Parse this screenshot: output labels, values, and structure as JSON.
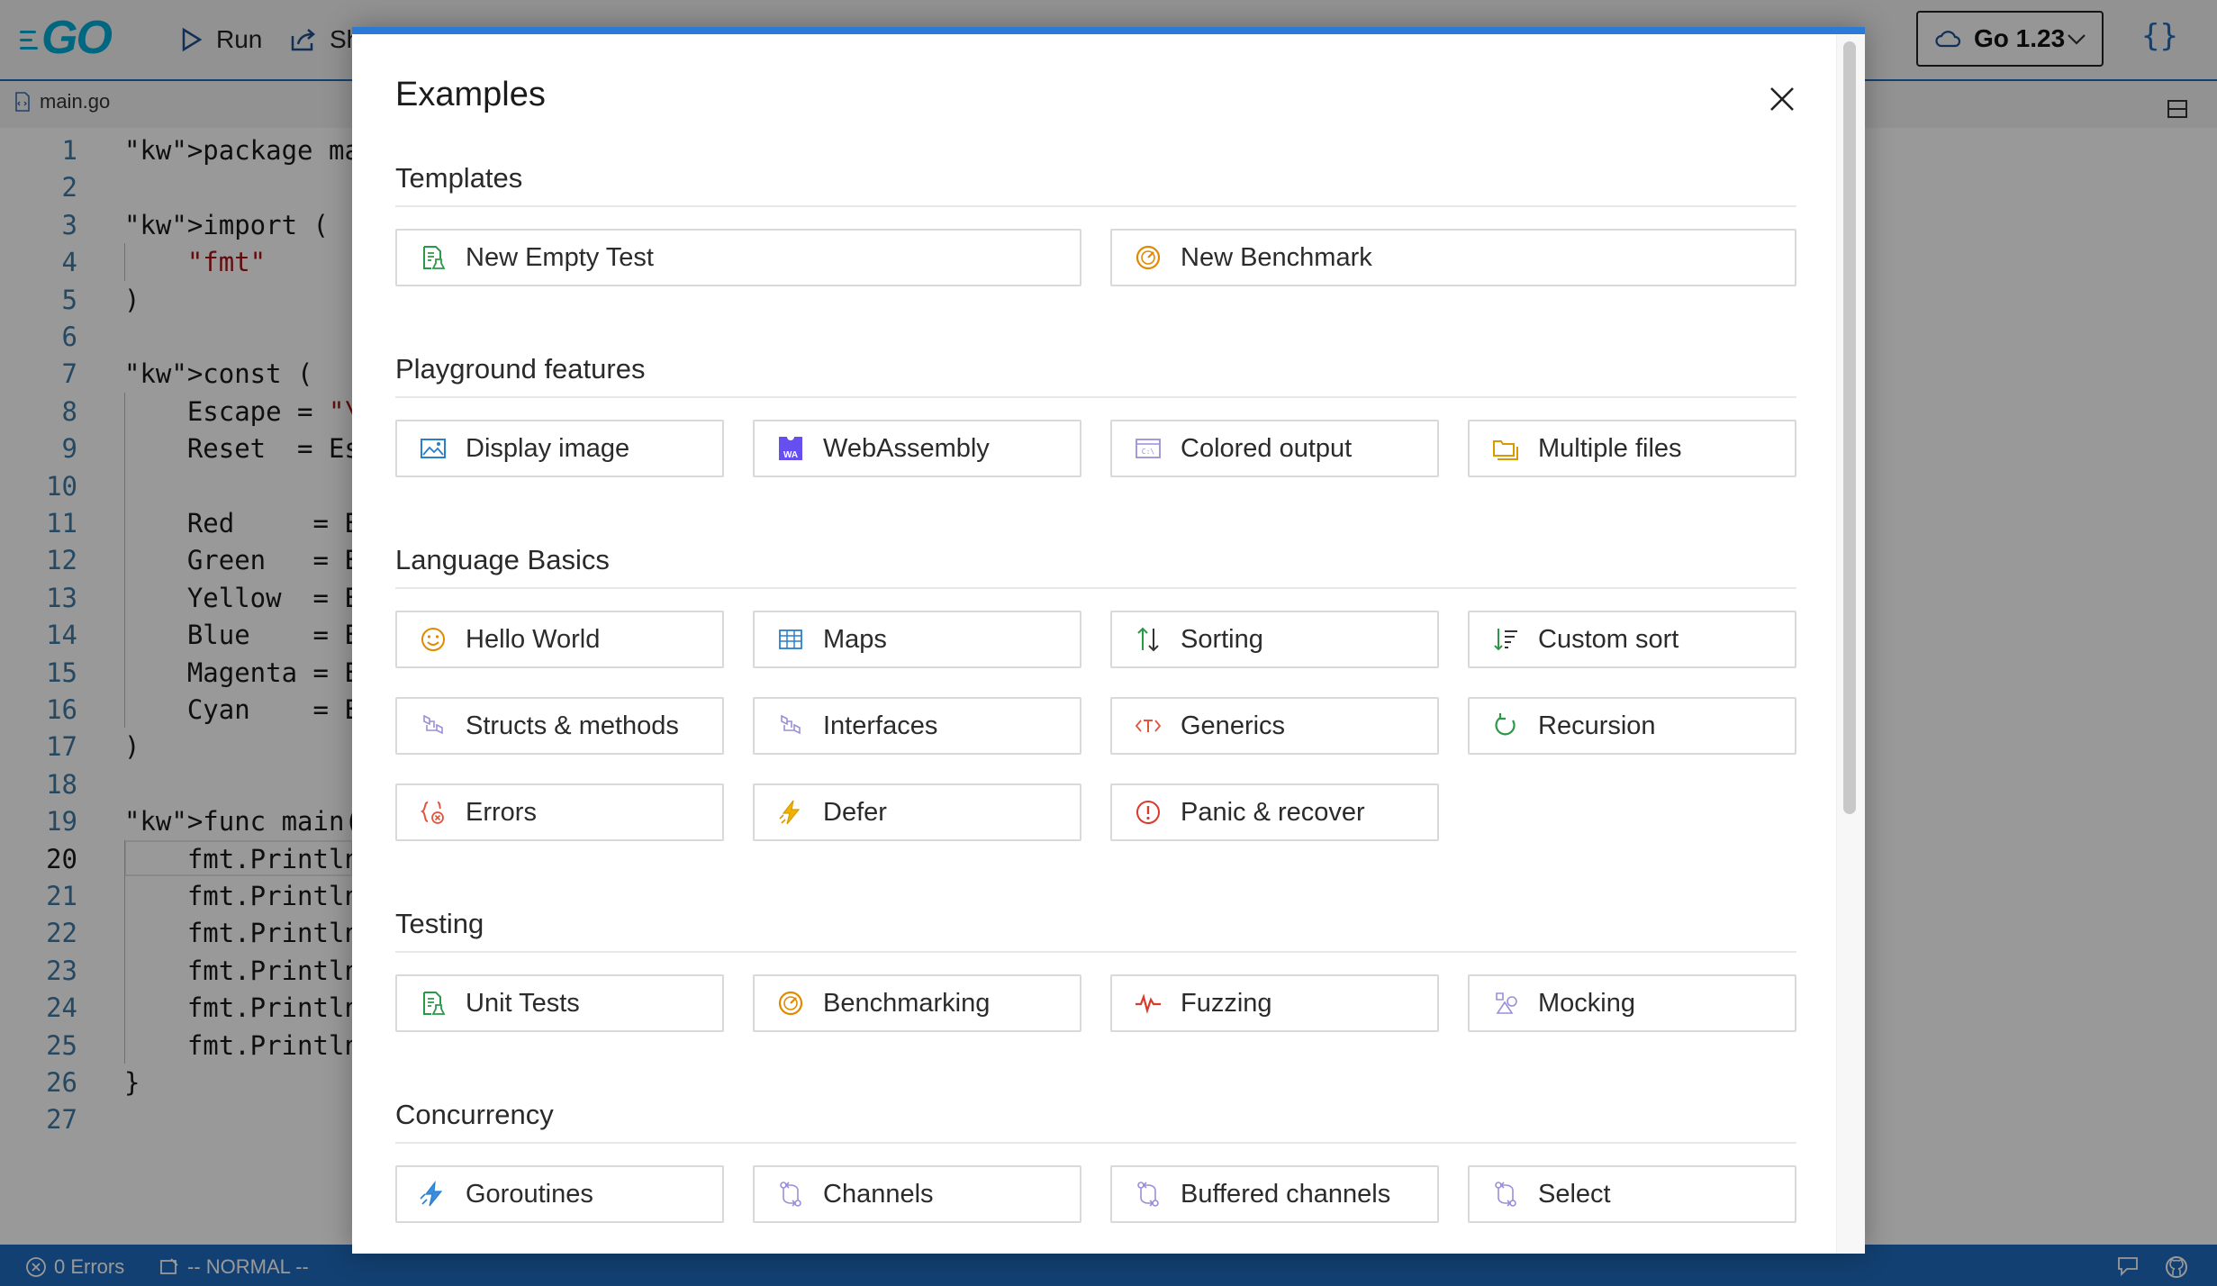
{
  "app": {
    "toolbar": {
      "run_label": "Run",
      "share_label": "Sh"
    },
    "version": "Go 1.23",
    "format_glyph": "{}",
    "file_tab": "main.go",
    "current_line": 20,
    "code_lines": [
      {
        "n": "1",
        "text": "package main"
      },
      {
        "n": "2",
        "text": ""
      },
      {
        "n": "3",
        "text": "import ("
      },
      {
        "n": "4",
        "text": "    \"fmt\""
      },
      {
        "n": "5",
        "text": ")"
      },
      {
        "n": "6",
        "text": ""
      },
      {
        "n": "7",
        "text": "const ("
      },
      {
        "n": "8",
        "text": "    Escape = \"\\"
      },
      {
        "n": "9",
        "text": "    Reset  = Es"
      },
      {
        "n": "10",
        "text": ""
      },
      {
        "n": "11",
        "text": "    Red     = E"
      },
      {
        "n": "12",
        "text": "    Green   = E"
      },
      {
        "n": "13",
        "text": "    Yellow  = E"
      },
      {
        "n": "14",
        "text": "    Blue    = E"
      },
      {
        "n": "15",
        "text": "    Magenta = E"
      },
      {
        "n": "16",
        "text": "    Cyan    = E"
      },
      {
        "n": "17",
        "text": ")"
      },
      {
        "n": "18",
        "text": ""
      },
      {
        "n": "19",
        "text": "func main() {"
      },
      {
        "n": "20",
        "text": "    fmt.Println"
      },
      {
        "n": "21",
        "text": "    fmt.Println"
      },
      {
        "n": "22",
        "text": "    fmt.Println"
      },
      {
        "n": "23",
        "text": "    fmt.Println"
      },
      {
        "n": "24",
        "text": "    fmt.Println"
      },
      {
        "n": "25",
        "text": "    fmt.Println"
      },
      {
        "n": "26",
        "text": "}"
      },
      {
        "n": "27",
        "text": ""
      }
    ],
    "status": {
      "errors": "0 Errors",
      "mode": "-- NORMAL --"
    }
  },
  "modal": {
    "title": "Examples",
    "sections": [
      {
        "title": "Templates",
        "columns": 2,
        "items": [
          {
            "label": "New Empty Test",
            "icon": "test-file-icon"
          },
          {
            "label": "New Benchmark",
            "icon": "gauge-icon"
          }
        ]
      },
      {
        "title": "Playground features",
        "columns": 4,
        "items": [
          {
            "label": "Display image",
            "icon": "image-icon"
          },
          {
            "label": "WebAssembly",
            "icon": "webassembly-icon"
          },
          {
            "label": "Colored output",
            "icon": "terminal-icon"
          },
          {
            "label": "Multiple files",
            "icon": "folders-icon"
          }
        ]
      },
      {
        "title": "Language Basics",
        "columns": 4,
        "items": [
          {
            "label": "Hello World",
            "icon": "smiley-icon"
          },
          {
            "label": "Maps",
            "icon": "table-icon"
          },
          {
            "label": "Sorting",
            "icon": "sort-arrows-icon"
          },
          {
            "label": "Custom sort",
            "icon": "sort-list-icon"
          },
          {
            "label": "Structs & methods",
            "icon": "struct-icon"
          },
          {
            "label": "Interfaces",
            "icon": "interface-icon"
          },
          {
            "label": "Generics",
            "icon": "generics-icon"
          },
          {
            "label": "Recursion",
            "icon": "recursion-icon"
          },
          {
            "label": "Errors",
            "icon": "error-braces-icon"
          },
          {
            "label": "Defer",
            "icon": "lightning-icon"
          },
          {
            "label": "Panic & recover",
            "icon": "alert-circle-icon"
          }
        ]
      },
      {
        "title": "Testing",
        "columns": 4,
        "items": [
          {
            "label": "Unit Tests",
            "icon": "test-file-icon"
          },
          {
            "label": "Benchmarking",
            "icon": "gauge-icon"
          },
          {
            "label": "Fuzzing",
            "icon": "pulse-icon"
          },
          {
            "label": "Mocking",
            "icon": "shapes-icon"
          }
        ]
      },
      {
        "title": "Concurrency",
        "columns": 4,
        "items": [
          {
            "label": "Goroutines",
            "icon": "goroutine-icon"
          },
          {
            "label": "Channels",
            "icon": "channel-icon"
          },
          {
            "label": "Buffered channels",
            "icon": "channel-icon"
          },
          {
            "label": "Select",
            "icon": "channel-icon"
          }
        ]
      }
    ]
  },
  "colors": {
    "accent": "#1f6bbf",
    "modal_border": "#2d7ad6",
    "go_cyan": "#00acd7"
  }
}
